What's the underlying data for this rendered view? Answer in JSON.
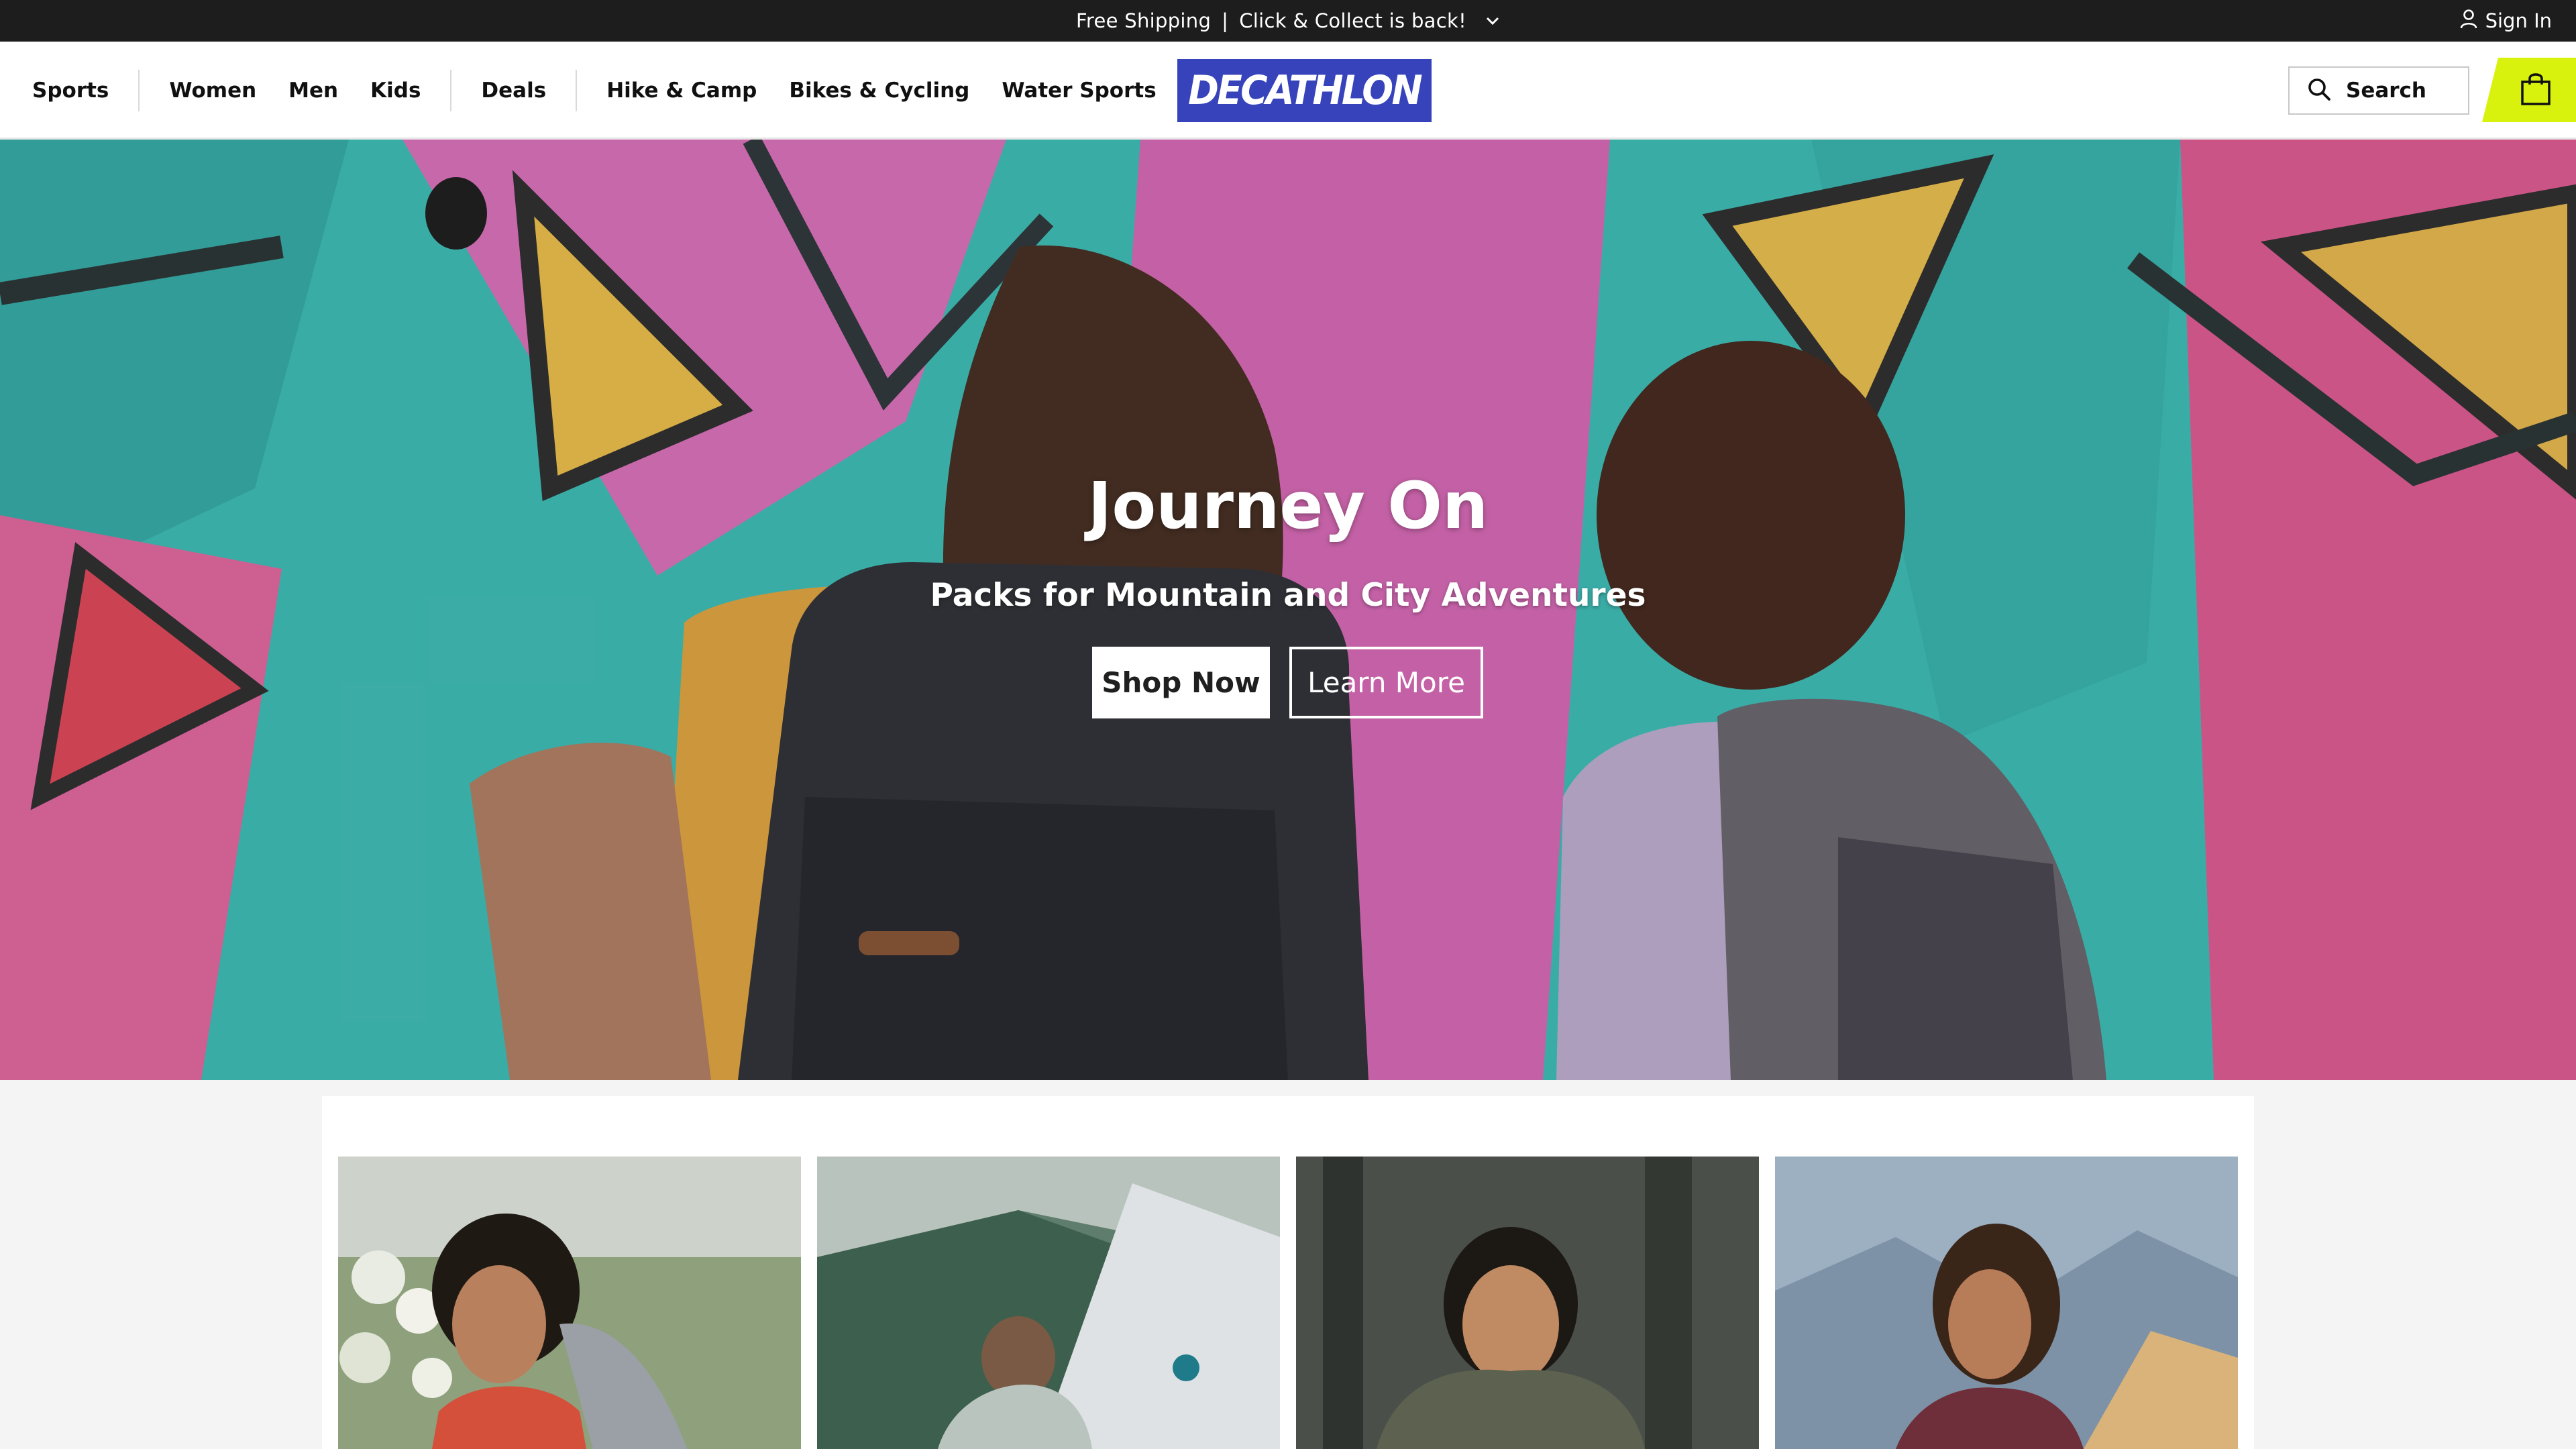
{
  "promo": {
    "text_1": "Free Shipping",
    "separator": "|",
    "text_2": "Click & Collect is back!",
    "chevron_icon": "chevron-down-icon"
  },
  "account": {
    "signin_label": "Sign In",
    "icon": "user-icon"
  },
  "nav": {
    "sports": "Sports",
    "women": "Women",
    "men": "Men",
    "kids": "Kids",
    "deals": "Deals",
    "hike_camp": "Hike & Camp",
    "bikes_cycling": "Bikes & Cycling",
    "water_sports": "Water Sports"
  },
  "logo": {
    "text": "DECATHLON",
    "color": "#3643ba"
  },
  "search": {
    "label": "Search",
    "icon": "search-icon"
  },
  "cart": {
    "icon": "shopping-bag-icon",
    "color": "#d9f20d"
  },
  "hero": {
    "title": "Journey On",
    "subtitle": "Packs for Mountain and City Adventures",
    "shop_now": "Shop Now",
    "learn_more": "Learn More"
  },
  "cards": [
    {
      "scene": "woman-hiker-flowers"
    },
    {
      "scene": "tent-mountains"
    },
    {
      "scene": "woman-puffer-jacket"
    },
    {
      "scene": "woman-mountain-view"
    }
  ]
}
